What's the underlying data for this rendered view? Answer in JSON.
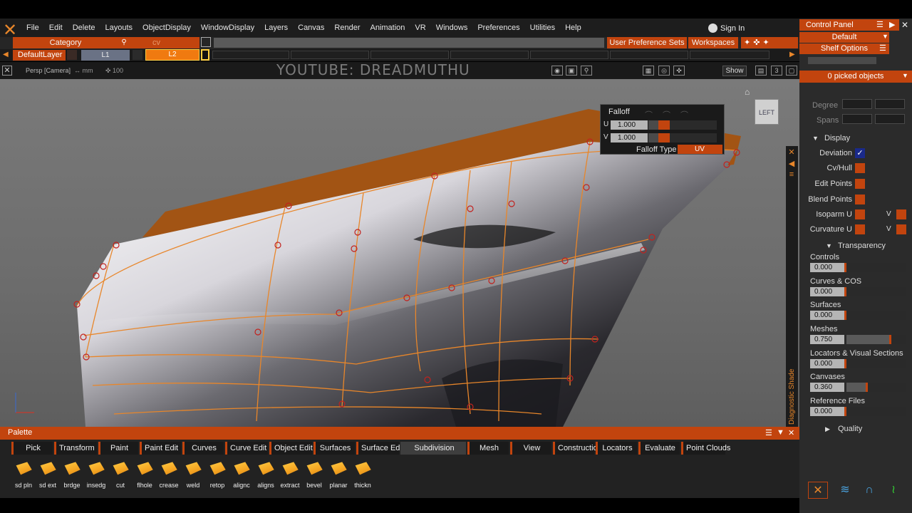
{
  "app": {
    "logo_text": "xfrmcv"
  },
  "menu": [
    "File",
    "Edit",
    "Delete",
    "Layouts",
    "ObjectDisplay",
    "WindowDisplay",
    "Layers",
    "Canvas",
    "Render",
    "Animation",
    "VR",
    "Windows",
    "Preferences",
    "Utilities",
    "Help"
  ],
  "account": {
    "signin_label": "Sign In"
  },
  "toolbar": {
    "category_label": "Category",
    "cv_label": "cv",
    "user_pref_label": "User Preference Sets",
    "workspaces_label": "Workspaces"
  },
  "layers": {
    "default": "DefaultLayer",
    "l1": "L1",
    "l2": "L2"
  },
  "viewport": {
    "camera": "Persp [Camera]",
    "unit": "mm",
    "scale": "100",
    "watermark": "YOUTUBE: DREADMUTHU",
    "show_label": "Show",
    "count": "3",
    "cube_label": "LEFT",
    "diag_label": "Diagnostic Shade"
  },
  "falloff": {
    "title": "Falloff",
    "u_label": "U",
    "u_value": "1.000",
    "v_label": "V",
    "v_value": "1.000",
    "type_label": "Falloff Type",
    "type_value": "UV"
  },
  "palette": {
    "title": "Palette",
    "tabs": [
      "Pick",
      "Transform",
      "Paint",
      "Paint Edit",
      "Curves",
      "Curve Edit",
      "Object Edit",
      "Surfaces",
      "Surface Edit",
      "Subdivision",
      "Mesh",
      "View",
      "Construction",
      "Locators",
      "Evaluate",
      "Point Clouds"
    ],
    "active_tab": "Subdivision",
    "tools": [
      "sd pln",
      "sd ext",
      "brdge",
      "insedg",
      "cut",
      "flhole",
      "crease",
      "weld",
      "retop",
      "alignc",
      "aligns",
      "extract",
      "bevel",
      "planar",
      "thickn"
    ]
  },
  "control_panel": {
    "title": "Control Panel",
    "preset": "Default",
    "shelf_options": "Shelf Options",
    "picked": "0 picked objects",
    "degree_label": "Degree",
    "spans_label": "Spans",
    "display_label": "Display",
    "display_items": [
      {
        "label": "Deviation",
        "checked": true
      },
      {
        "label": "Cv/Hull",
        "checked": false
      },
      {
        "label": "Edit Points",
        "checked": false
      },
      {
        "label": "Blend Points",
        "checked": false
      },
      {
        "label": "Isoparm U",
        "checked": false,
        "v": "V"
      },
      {
        "label": "Curvature U",
        "checked": false,
        "v": "V"
      }
    ],
    "transparency_label": "Transparency",
    "transparency": [
      {
        "label": "Controls",
        "value": "0.000"
      },
      {
        "label": "Curves & COS",
        "value": "0.000"
      },
      {
        "label": "Surfaces",
        "value": "0.000"
      },
      {
        "label": "Meshes",
        "value": "0.750"
      },
      {
        "label": "Locators & Visual Sections",
        "value": "0.000"
      },
      {
        "label": "Canvases",
        "value": "0.360"
      },
      {
        "label": "Reference Files",
        "value": "0.000"
      }
    ],
    "quality_label": "Quality"
  },
  "colors": {
    "accent": "#c2440e",
    "highlight": "#f07a10",
    "curve": "#e8862a"
  }
}
